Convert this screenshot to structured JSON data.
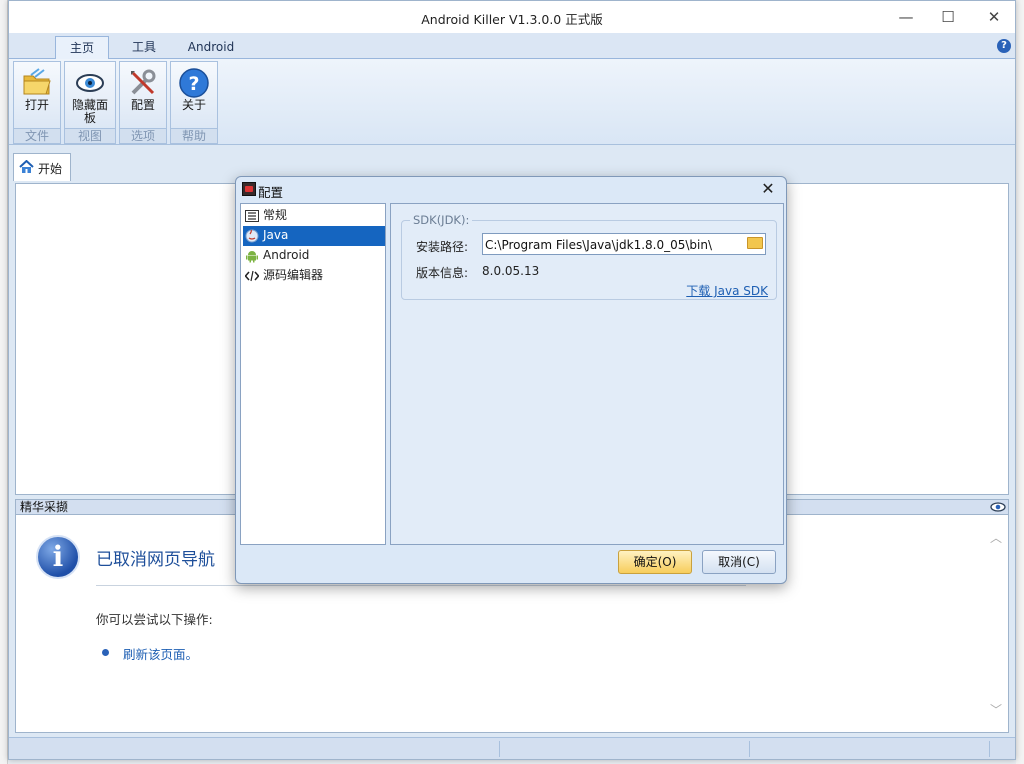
{
  "window": {
    "title": "Android Killer V1.3.0.0 正式版"
  },
  "window_controls": {
    "minimize": "—",
    "maximize": "☐",
    "close": "✕"
  },
  "ribbon": {
    "tabs": [
      {
        "label": "主页",
        "active": true
      },
      {
        "label": "工具",
        "active": false
      },
      {
        "label": "Android",
        "active": false
      }
    ],
    "help_glyph": "?",
    "buttons": [
      {
        "label": "打开",
        "icon": "folder-open-icon"
      },
      {
        "label": "隐藏面板",
        "icon": "eye-icon"
      },
      {
        "label": "配置",
        "icon": "tools-icon"
      },
      {
        "label": "关于",
        "icon": "help-icon"
      }
    ],
    "groups": [
      "文件",
      "视图",
      "选项",
      "帮助"
    ]
  },
  "doc_tab": {
    "label": "开始",
    "icon": "home-icon"
  },
  "panel": {
    "title": "精华采撷",
    "nav_title": "已取消网页导航",
    "nav_desc": "你可以尝试以下操作:",
    "nav_link": "刷新该页面。",
    "info_glyph": "i"
  },
  "dialog": {
    "title": "配置",
    "close_glyph": "✕",
    "tree": [
      {
        "label": "常规",
        "icon": "list-icon",
        "selected": false
      },
      {
        "label": "Java",
        "icon": "java-icon",
        "selected": true
      },
      {
        "label": "Android",
        "icon": "android-icon",
        "selected": false
      },
      {
        "label": "源码编辑器",
        "icon": "code-icon",
        "selected": false
      }
    ],
    "group_label": "SDK(JDK):",
    "path_label": "安装路径:",
    "path_value": "C:\\Program Files\\Java\\jdk1.8.0_05\\bin\\",
    "version_label": "版本信息:",
    "version_value": "8.0.05.13",
    "download_link": "下载 Java SDK",
    "ok_button": "确定(O)",
    "cancel_button": "取消(C)"
  },
  "colors": {
    "accent": "#1565c0",
    "link": "#1e5fb3",
    "ok_button": "#f7cd5c"
  }
}
